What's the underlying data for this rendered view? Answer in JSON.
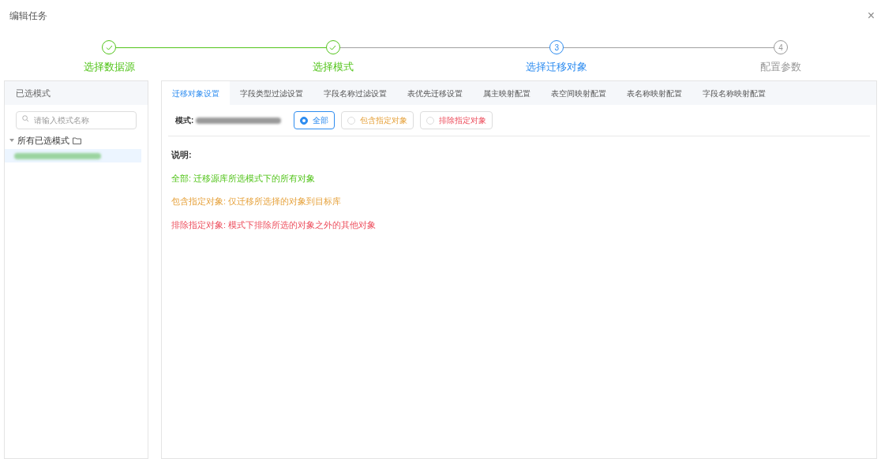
{
  "dialog": {
    "title": "编辑任务",
    "close": "×"
  },
  "steps": [
    {
      "label": "选择数据源",
      "done": true,
      "active": false
    },
    {
      "label": "选择模式",
      "done": true,
      "active": false
    },
    {
      "number": "3",
      "label": "选择迁移对象",
      "done": false,
      "active": true
    },
    {
      "number": "4",
      "label": "配置参数",
      "done": false,
      "active": false
    }
  ],
  "sidebar": {
    "title": "已选模式",
    "search": {
      "placeholder": "请输入模式名称"
    },
    "tree": [
      {
        "label": "所有已选模式",
        "expanded": true,
        "children": [
          {
            "selected": true
          }
        ]
      }
    ]
  },
  "tabs": [
    {
      "label": "迁移对象设置",
      "selected": true
    },
    {
      "label": "字段类型过滤设置",
      "selected": false
    },
    {
      "label": "字段名称过滤设置",
      "selected": false
    },
    {
      "label": "表优先迁移设置",
      "selected": false
    },
    {
      "label": "属主映射配置",
      "selected": false
    },
    {
      "label": "表空间映射配置",
      "selected": false
    },
    {
      "label": "表名称映射配置",
      "selected": false
    },
    {
      "label": "字段名称映射配置",
      "selected": false
    }
  ],
  "mode_label": "模式:",
  "options": [
    {
      "label": "全部",
      "selected": true,
      "kind": "all"
    },
    {
      "label": "包含指定对象",
      "selected": false,
      "kind": "include"
    },
    {
      "label": "排除指定对象",
      "selected": false,
      "kind": "exclude"
    }
  ],
  "notes_title": "说明:",
  "notes": [
    {
      "text": "全部: 迁移源库所选模式下的所有对象",
      "kind": "all"
    },
    {
      "text": "包含指定对象: 仅迁移所选择的对象到目标库",
      "kind": "include"
    },
    {
      "text": "排除指定对象: 模式下排除所选的对象之外的其他对象",
      "kind": "exclude"
    }
  ]
}
